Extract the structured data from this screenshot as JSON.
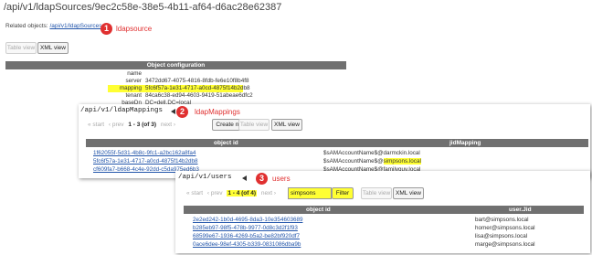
{
  "header": {
    "title": "/api/v1/ldapSources/9ec2c58e-38e5-4b11-af64-d6ac28e62387",
    "related_label": "Related objects:",
    "related_link": "/api/v1/ldapSources"
  },
  "annotations": [
    {
      "number": "1",
      "label": "ldapsource"
    },
    {
      "number": "2",
      "label": "ldapMappings"
    },
    {
      "number": "3",
      "label": "users"
    }
  ],
  "view_toggle": {
    "table_view": "Table view",
    "xml_view": "XML view"
  },
  "object_config": {
    "title": "Object configuration",
    "rows": [
      {
        "key": "name",
        "value": ""
      },
      {
        "key": "server",
        "value": "3472dd67-4075-4816-8fdb-fe6e10f8b4f8"
      },
      {
        "key": "mapping",
        "value": "5fc6f57a-1e31-4717-a0cd-4875f14b2db8"
      },
      {
        "key": "tenant",
        "value": "84ca6c38-ed94-4603-9419-51abeae6dfc2"
      },
      {
        "key": "baseDn",
        "value": "DC=dell,DC=local"
      }
    ]
  },
  "ldap_mappings": {
    "path": "/api/v1/ldapMappings",
    "pager": {
      "start": "« start",
      "prev": "‹ prev",
      "range": "1 - 3 (of 3)",
      "next": "next ›"
    },
    "create_new": "Create new",
    "columns": [
      "object id",
      "jidMapping"
    ],
    "rows": [
      {
        "id": "1f62055f-5d31-4b8c-9fc1-a2bc162a8fa4",
        "mapping_prefix": "$sAMAccountName$@",
        "mapping_domain": "darmckin.local"
      },
      {
        "id": "5fc6f57a-1e31-4717-a0cd-4875f14b2db8",
        "mapping_prefix": "$sAMAccountName$@",
        "mapping_domain": "simpsons.local"
      },
      {
        "id": "cf609fa7-b668-4c4e-92dd-c5da975ed6b3",
        "mapping_prefix": "$sAMAccountName$@",
        "mapping_domain": "familyguy.local"
      }
    ]
  },
  "users": {
    "path": "/api/v1/users",
    "pager": {
      "start": "« start",
      "prev": "‹ prev",
      "range": "1 - 4 (of 4)",
      "next": "next ›"
    },
    "filter_value": "simpsons",
    "filter_button": "Filter",
    "columns": [
      "object id",
      "user.Jid"
    ],
    "rows": [
      {
        "id": "2e2ed242-1b0d-4695-8da3-10e354603689",
        "jid": "bart@simpsons.local"
      },
      {
        "id": "b285eb97-98f5-478b-9977-0d8c3d2f1f93",
        "jid": "homer@simpsons.local"
      },
      {
        "id": "68599e67-1936-4269-b5a2-be82bf920df7",
        "jid": "lisa@simpsons.local"
      },
      {
        "id": "0ace6dee-98ef-4305-b339-0831086dba9b",
        "jid": "marge@simpsons.local"
      }
    ]
  },
  "colors": {
    "annotation": "#e03030",
    "highlight": "#ffff33",
    "table_header": "#707070",
    "link": "#2255aa"
  }
}
